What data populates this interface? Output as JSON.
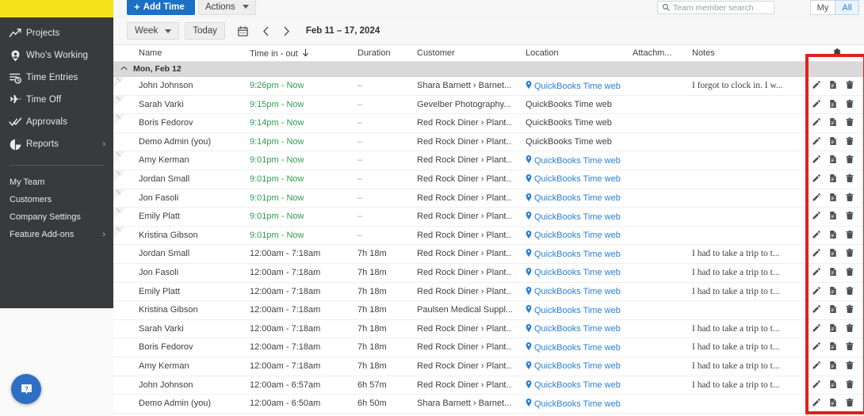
{
  "sidebar": {
    "items": [
      {
        "label": "Projects",
        "icon": "trending-up-icon",
        "chevron": false
      },
      {
        "label": "Who's Working",
        "icon": "map-pin-icon",
        "chevron": false
      },
      {
        "label": "Time Entries",
        "icon": "time-entries-icon",
        "chevron": false
      },
      {
        "label": "Time Off",
        "icon": "airplane-icon",
        "chevron": false
      },
      {
        "label": "Approvals",
        "icon": "double-check-icon",
        "chevron": false
      },
      {
        "label": "Reports",
        "icon": "pie-chart-icon",
        "chevron": true
      }
    ],
    "sub_items": [
      {
        "label": "My Team",
        "chevron": false
      },
      {
        "label": "Customers",
        "chevron": false
      },
      {
        "label": "Company Settings",
        "chevron": false
      },
      {
        "label": "Feature Add-ons",
        "chevron": true
      }
    ],
    "help_icon": "help-question-icon"
  },
  "topbar": {
    "add_time_label": "Add Time",
    "add_time_plus": "+",
    "actions_label": "Actions",
    "search_placeholder": "Team member search",
    "search_value": "",
    "search_icon": "search-icon",
    "my_label": "My",
    "all_label": "All",
    "active_scope": "All"
  },
  "toolbar": {
    "range_label": "Week",
    "today_label": "Today",
    "calendar_icon": "calendar-icon",
    "prev_icon": "chevron-left-icon",
    "next_icon": "chevron-right-icon",
    "date_range": "Feb 11 – 17, 2024"
  },
  "table": {
    "columns": [
      "Name",
      "Time in - out",
      "Duration",
      "Customer",
      "Location",
      "Attachm...",
      "Notes"
    ],
    "sort_column": "Time in - out",
    "sort_icon": "arrow-down-icon",
    "settings_icon": "gear-icon",
    "group_label": "Mon, Feb 12",
    "group_collapse_icon": "chevron-up-icon",
    "row_actions": [
      {
        "icon": "pencil-icon",
        "name": "edit-entry-button"
      },
      {
        "icon": "document-icon",
        "name": "duplicate-entry-button"
      },
      {
        "icon": "trash-icon",
        "name": "delete-entry-button"
      }
    ],
    "rows": [
      {
        "name": "John Johnson",
        "time": "9:26pm - Now",
        "running": true,
        "duration": "–",
        "customer": "Shara Barnett › Barnet...",
        "location": "QuickBooks Time web",
        "location_link": true,
        "notes": "I forgot to clock in. I w...",
        "active": true
      },
      {
        "name": "Sarah Varki",
        "time": "9:15pm - Now",
        "running": true,
        "duration": "–",
        "customer": "Gevelber Photography...",
        "location": "QuickBooks Time web",
        "location_link": false,
        "notes": "",
        "active": true
      },
      {
        "name": "Boris Fedorov",
        "time": "9:14pm - Now",
        "running": true,
        "duration": "–",
        "customer": "Red Rock Diner › Plant...",
        "location": "QuickBooks Time web",
        "location_link": false,
        "notes": "",
        "active": true
      },
      {
        "name": "Demo Admin (you)",
        "time": "9:14pm - Now",
        "running": true,
        "duration": "–",
        "customer": "Red Rock Diner › Plant...",
        "location": "QuickBooks Time web",
        "location_link": false,
        "notes": "",
        "active": false
      },
      {
        "name": "Amy Kerman",
        "time": "9:01pm - Now",
        "running": true,
        "duration": "–",
        "customer": "Red Rock Diner › Plant...",
        "location": "QuickBooks Time web",
        "location_link": true,
        "notes": "",
        "active": true
      },
      {
        "name": "Jordan Small",
        "time": "9:01pm - Now",
        "running": true,
        "duration": "–",
        "customer": "Red Rock Diner › Plant...",
        "location": "QuickBooks Time web",
        "location_link": true,
        "notes": "",
        "active": true
      },
      {
        "name": "Jon Fasoli",
        "time": "9:01pm - Now",
        "running": true,
        "duration": "–",
        "customer": "Red Rock Diner › Plant...",
        "location": "QuickBooks Time web",
        "location_link": true,
        "notes": "",
        "active": true
      },
      {
        "name": "Emily Platt",
        "time": "9:01pm - Now",
        "running": true,
        "duration": "–",
        "customer": "Red Rock Diner › Plant...",
        "location": "QuickBooks Time web",
        "location_link": true,
        "notes": "",
        "active": true
      },
      {
        "name": "Kristina Gibson",
        "time": "9:01pm - Now",
        "running": true,
        "duration": "–",
        "customer": "Red Rock Diner › Plant...",
        "location": "QuickBooks Time web",
        "location_link": true,
        "notes": "",
        "active": true
      },
      {
        "name": "Jordan Small",
        "time": "12:00am - 7:18am",
        "running": false,
        "duration": "7h 18m",
        "customer": "Red Rock Diner › Plant...",
        "location": "QuickBooks Time web",
        "location_link": true,
        "notes": "I had to take a trip to t...",
        "active": false
      },
      {
        "name": "Jon Fasoli",
        "time": "12:00am - 7:18am",
        "running": false,
        "duration": "7h 18m",
        "customer": "Red Rock Diner › Plant...",
        "location": "QuickBooks Time web",
        "location_link": true,
        "notes": "I had to take a trip to t...",
        "active": false
      },
      {
        "name": "Emily Platt",
        "time": "12:00am - 7:18am",
        "running": false,
        "duration": "7h 18m",
        "customer": "Red Rock Diner › Plant...",
        "location": "QuickBooks Time web",
        "location_link": true,
        "notes": "I had to take a trip to t...",
        "active": false
      },
      {
        "name": "Kristina Gibson",
        "time": "12:00am - 7:18am",
        "running": false,
        "duration": "7h 18m",
        "customer": "Paulsen Medical Suppl...",
        "location": "QuickBooks Time web",
        "location_link": true,
        "notes": "",
        "active": false
      },
      {
        "name": "Sarah Varki",
        "time": "12:00am - 7:18am",
        "running": false,
        "duration": "7h 18m",
        "customer": "Red Rock Diner › Plant...",
        "location": "QuickBooks Time web",
        "location_link": true,
        "notes": "I had to take a trip to t...",
        "active": false
      },
      {
        "name": "Boris Fedorov",
        "time": "12:00am - 7:18am",
        "running": false,
        "duration": "7h 18m",
        "customer": "Red Rock Diner › Plant...",
        "location": "QuickBooks Time web",
        "location_link": true,
        "notes": "I had to take a trip to t...",
        "active": false
      },
      {
        "name": "Amy Kerman",
        "time": "12:00am - 7:18am",
        "running": false,
        "duration": "7h 18m",
        "customer": "Red Rock Diner › Plant...",
        "location": "QuickBooks Time web",
        "location_link": true,
        "notes": "I had to take a trip to t...",
        "active": false
      },
      {
        "name": "John Johnson",
        "time": "12:00am - 6:57am",
        "running": false,
        "duration": "6h 57m",
        "customer": "Red Rock Diner › Plant...",
        "location": "QuickBooks Time web",
        "location_link": true,
        "notes": "I had to take a trip to t...",
        "active": false
      },
      {
        "name": "Demo Admin (you)",
        "time": "12:00am - 6:50am",
        "running": false,
        "duration": "6h 50m",
        "customer": "Shara Barnett › Barnet...",
        "location": "QuickBooks Time web",
        "location_link": true,
        "notes": "",
        "active": false
      }
    ]
  },
  "annotation": {
    "highlight_color": "#e02020"
  },
  "colors": {
    "brand_yellow": "#f5e21a",
    "sidebar_dark": "#393a3d",
    "accent_blue": "#1b6fc4",
    "link_blue": "#2b7fd4",
    "running_green": "#2e9e4f",
    "group_gray": "#d9d9d9"
  }
}
